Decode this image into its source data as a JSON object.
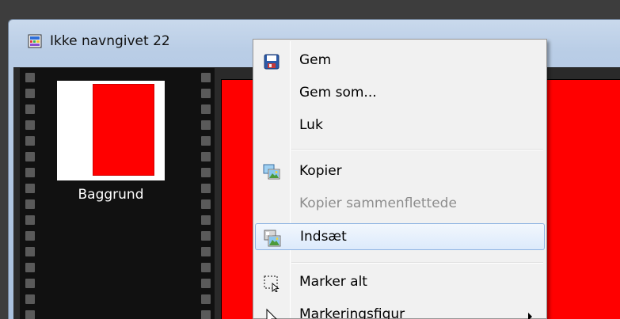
{
  "window": {
    "title": "Ikke navngivet 22",
    "icon": "document-icon"
  },
  "filmstrip": {
    "layers": [
      {
        "label": "Baggrund",
        "thumbnail_color": "#ff0000"
      }
    ]
  },
  "canvas": {
    "fill_color": "#ff0000"
  },
  "context_menu": {
    "items": [
      {
        "label": "Gem",
        "icon": "save-icon",
        "enabled": true
      },
      {
        "label": "Gem som...",
        "icon": "",
        "enabled": true
      },
      {
        "label": "Luk",
        "icon": "",
        "enabled": true
      },
      {
        "label": "Kopier",
        "icon": "copy-image-icon",
        "enabled": true
      },
      {
        "label": "Kopier sammenflettede",
        "icon": "",
        "enabled": false
      },
      {
        "label": "Indsæt",
        "icon": "paste-image-icon",
        "enabled": true,
        "highlighted": true
      },
      {
        "label": "Marker alt",
        "icon": "select-all-icon",
        "enabled": true
      },
      {
        "label": "Markeringsfigur",
        "icon": "selection-shape-icon",
        "enabled": true,
        "submenu": true
      }
    ]
  }
}
